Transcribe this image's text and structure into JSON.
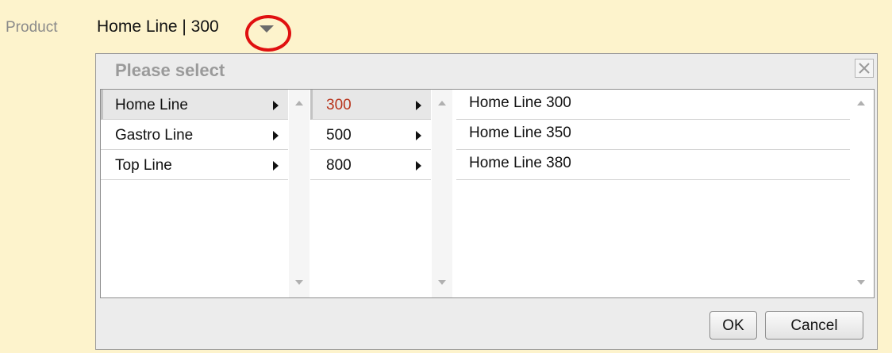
{
  "field": {
    "label": "Product",
    "value": "Home Line | 300"
  },
  "dialog": {
    "title": "Please select",
    "column1": [
      {
        "label": "Home Line",
        "selected": true
      },
      {
        "label": "Gastro Line",
        "selected": false
      },
      {
        "label": "Top Line",
        "selected": false
      }
    ],
    "column2": [
      {
        "label": "300",
        "selected": true
      },
      {
        "label": "500",
        "selected": false
      },
      {
        "label": "800",
        "selected": false
      }
    ],
    "column3": [
      {
        "label": "Home Line 300"
      },
      {
        "label": "Home Line 350"
      },
      {
        "label": "Home Line 380"
      }
    ],
    "ok_label": "OK",
    "cancel_label": "Cancel"
  },
  "colors": {
    "background": "#fdf3cc",
    "highlight_ring": "#e01010",
    "selected_text": "#b8341c"
  },
  "icons": [
    "dropdown-arrow-icon",
    "close-icon",
    "chevron-right-icon",
    "scroll-up-icon",
    "scroll-down-icon"
  ]
}
